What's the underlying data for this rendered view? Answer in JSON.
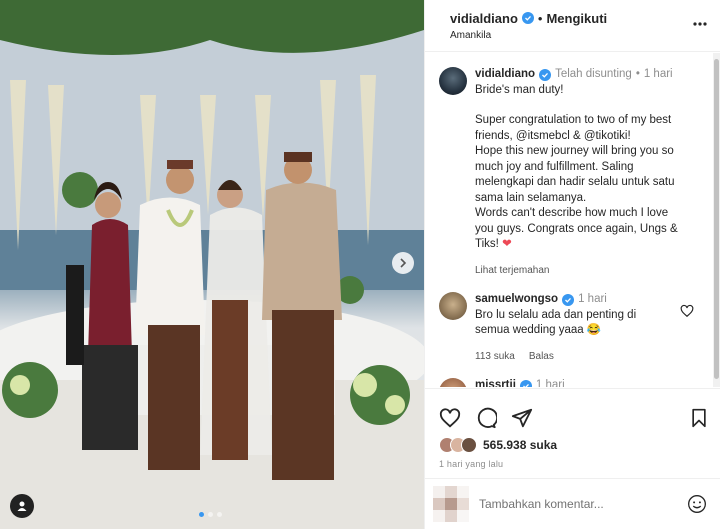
{
  "header": {
    "username": "vidialdiano",
    "separator": "•",
    "follow_label": "Mengikuti",
    "location": "Amankila",
    "more_icon": "more-horizontal-icon"
  },
  "caption": {
    "username": "vidialdiano",
    "edited": "Telah disunting",
    "time": "1 hari",
    "line1": "Bride's man duty!",
    "line2": "Super congratulation to two of my best\nfriends, @itsmebcl & @tikotiki!\nHope this new journey will bring you so\nmuch joy and fulfillment. Saling\nmelengkapi dan hadir selalu untuk satu\nsama lain selamanya.\nWords can't describe how much I love\nyou guys. Congrats once again, Ungs &\nTiks!",
    "heart": "❤",
    "translate_label": "Lihat terjemahan"
  },
  "comments": [
    {
      "username": "samuelwongso",
      "time": "1 hari",
      "text": "Bro lu selalu ada dan penting di\nsemua wedding yaaa",
      "emoji": "😂",
      "likes": "113 suka",
      "reply_label": "Balas"
    },
    {
      "username": "missrtii",
      "time": "1 hari"
    }
  ],
  "actions": {
    "likes_count": "565.938",
    "likes_suffix": "suka",
    "date": "1 hari yang lalu"
  },
  "add_comment": {
    "placeholder": "Tambahkan komentar..."
  },
  "carousel": {
    "dot_count": 3,
    "active_dot": 1
  },
  "colors": {
    "verified": "#3897f0",
    "heart": "#ed4956",
    "text": "#262626",
    "muted": "#8e8e8e"
  }
}
